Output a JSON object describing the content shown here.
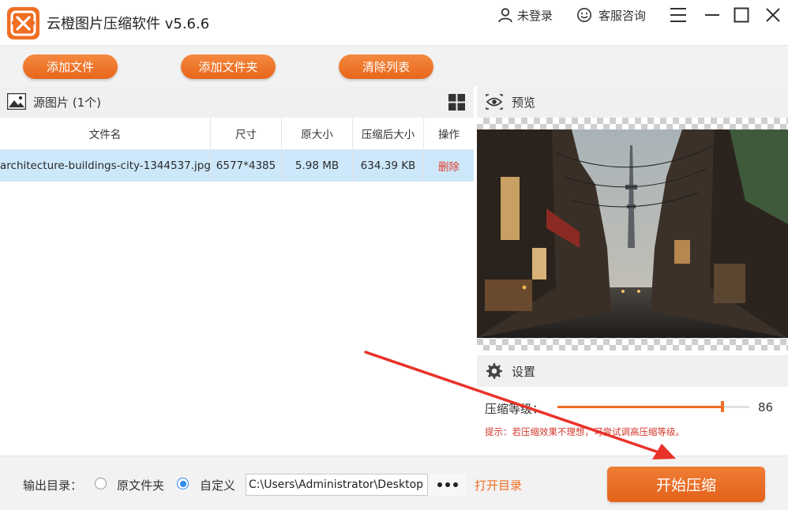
{
  "app": {
    "title": "云橙图片压缩软件 v5.6.6"
  },
  "header": {
    "login_label": "未登录",
    "service_label": "客服咨询"
  },
  "toolbar": {
    "add_file": "添加文件",
    "add_folder": "添加文件夹",
    "clear_list": "清除列表"
  },
  "source": {
    "label": "源图片 (1个)"
  },
  "table": {
    "columns": [
      "文件名",
      "尺寸",
      "原大小",
      "压缩后大小",
      "操作"
    ],
    "rows": [
      {
        "filename": "architecture-buildings-city-1344537.jpg",
        "dimensions": "6577*4385",
        "original_size": "5.98 MB",
        "compressed_size": "634.39 KB",
        "action": "删除"
      }
    ]
  },
  "preview": {
    "label": "预览"
  },
  "settings": {
    "label": "设置",
    "compression_label": "压缩等级：",
    "compression_value": 86,
    "compression_value_text": "86",
    "hint": "提示：若压缩效果不理想，可尝试调高压缩等级。"
  },
  "output": {
    "label": "输出目录：",
    "option_original": "原文件夹",
    "option_custom": "自定义",
    "selected": "自定义",
    "path": "C:\\Users\\Administrator\\Desktop",
    "open_folder": "打开目录"
  },
  "start_button": "开始压缩",
  "colors": {
    "accent": "#ef6e23",
    "delete": "#e23d2c",
    "selected_row": "#cde8fb",
    "radio_selected": "#2d8cf0",
    "annotation_arrow": "#e8322a"
  }
}
